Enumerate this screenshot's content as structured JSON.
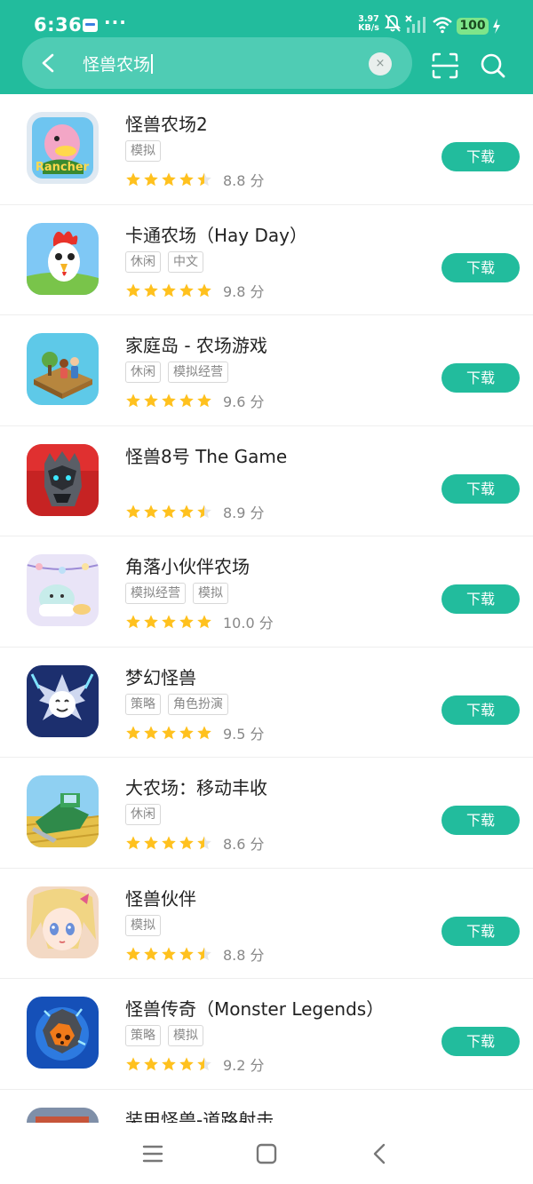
{
  "status_bar": {
    "time": "6:36",
    "dots": "···",
    "net_speed_value": "3.97",
    "net_speed_unit": "KB/s",
    "battery": "100",
    "icons": [
      "notification-app-icon",
      "mute-bell-icon",
      "cell-signal-icon",
      "wifi-icon",
      "charging-icon"
    ]
  },
  "search": {
    "query": "怪兽农场",
    "clear_glyph": "×"
  },
  "header_icons": [
    "back-arrow-icon",
    "clear-icon",
    "scan-icon",
    "search-icon"
  ],
  "colors": {
    "accent": "#22bc9d",
    "search_box": "#4fccb4",
    "star": "#ffc11e",
    "star_empty": "#e6e6e6"
  },
  "apps": [
    {
      "name": "怪兽农场2",
      "tags": [
        "模拟"
      ],
      "rating_stars": 4.5,
      "score": "8.8 分",
      "button": "下载",
      "icon": "monster-farm-2-icon"
    },
    {
      "name": "卡通农场（Hay Day）",
      "tags": [
        "休闲",
        "中文"
      ],
      "rating_stars": 5,
      "score": "9.8 分",
      "button": "下载",
      "icon": "hay-day-rooster-icon"
    },
    {
      "name": "家庭岛 - 农场游戏",
      "tags": [
        "休闲",
        "模拟经营"
      ],
      "rating_stars": 5,
      "score": "9.6 分",
      "button": "下载",
      "icon": "family-island-icon"
    },
    {
      "name": "怪兽8号 The Game",
      "tags": [],
      "rating_stars": 4.5,
      "score": "8.9 分",
      "button": "下载",
      "icon": "kaiju-no8-icon"
    },
    {
      "name": "角落小伙伴农场",
      "tags": [
        "模拟经营",
        "模拟"
      ],
      "rating_stars": 5,
      "score": "10.0 分",
      "button": "下载",
      "icon": "sumikko-farm-icon"
    },
    {
      "name": "梦幻怪兽",
      "tags": [
        "策略",
        "角色扮演"
      ],
      "rating_stars": 5,
      "score": "9.5 分",
      "button": "下载",
      "icon": "fantasy-monster-icon"
    },
    {
      "name": "大农场：移动丰收",
      "tags": [
        "休闲"
      ],
      "rating_stars": 4.5,
      "score": "8.6 分",
      "button": "下载",
      "icon": "harvester-icon"
    },
    {
      "name": "怪兽伙伴",
      "tags": [
        "模拟"
      ],
      "rating_stars": 4.5,
      "score": "8.8 分",
      "button": "下载",
      "icon": "anime-girl-icon"
    },
    {
      "name": "怪兽传奇（Monster Legends）",
      "tags": [
        "策略",
        "模拟"
      ],
      "rating_stars": 4.5,
      "score": "9.2 分",
      "button": "下载",
      "icon": "monster-legends-egg-icon"
    },
    {
      "name": "装甲怪兽-道路射击",
      "tags": [],
      "rating_stars": 0,
      "score": "",
      "button": "",
      "icon": "armored-monster-icon"
    }
  ],
  "nav_bar": [
    "menu-icon",
    "home-icon",
    "back-icon"
  ]
}
